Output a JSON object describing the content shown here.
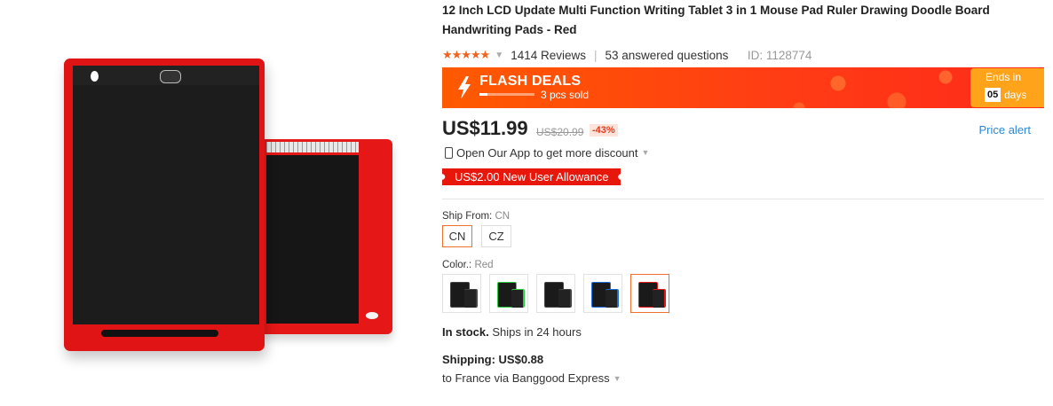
{
  "product": {
    "title": "12 Inch LCD Update Multi Function Writing Tablet 3 in 1 Mouse Pad Ruler Drawing Doodle Board Handwriting Pads - Red",
    "rating_stars": "★★★★★",
    "reviews": "1414 Reviews",
    "questions": "53 answered questions",
    "id_text": "ID: 1128774",
    "image_alt": "LCD writing tablet red"
  },
  "flash": {
    "title": "FLASH DEALS",
    "sold": "3 pcs sold",
    "sold_progress": 0.15,
    "ends_label": "Ends in",
    "ends_num": "05",
    "ends_unit": "days"
  },
  "price": {
    "current": "US$11.99",
    "original": "US$20.99",
    "discount": "-43%",
    "alert": "Price alert"
  },
  "app_promo": "Open Our App to get more discount",
  "allowance": "US$2.00 New User Allowance",
  "ship_from": {
    "label": "Ship From:",
    "value": "CN",
    "options": [
      "CN",
      "CZ"
    ]
  },
  "color": {
    "label": "Color.:",
    "value": "Red",
    "swatch_accents": [
      "#444444",
      "#2ecc40",
      "#444444",
      "#1e6fd9",
      "#e51717"
    ]
  },
  "stock": {
    "bold": "In stock.",
    "rest": " Ships in 24 hours"
  },
  "shipping": {
    "label": "Shipping: US$0.88",
    "to": "to France via Banggood Express"
  },
  "colors": {
    "brand_orange": "#ff5a00",
    "link_blue": "#2a87d8",
    "star_orange": "#f2621e",
    "allowance_red": "#e8170c"
  }
}
